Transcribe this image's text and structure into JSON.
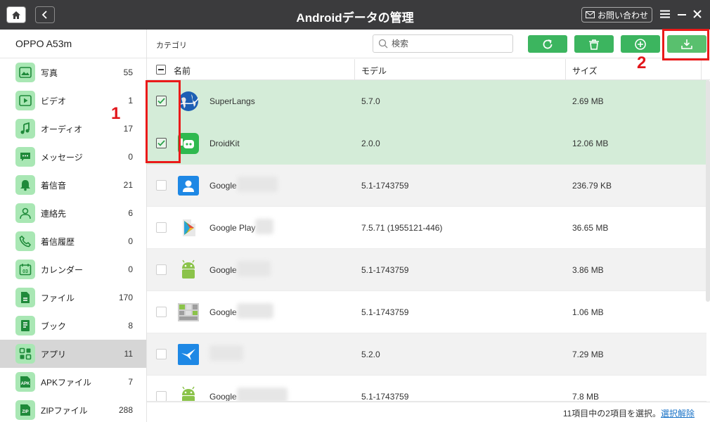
{
  "window": {
    "title": "Androidデータの管理",
    "contact_label": "お問い合わせ"
  },
  "sidebar": {
    "device": "OPPO A53m",
    "items": [
      {
        "label": "写真",
        "count": "55",
        "icon": "photo-icon"
      },
      {
        "label": "ビデオ",
        "count": "1",
        "icon": "video-icon"
      },
      {
        "label": "オーディオ",
        "count": "17",
        "icon": "music-icon"
      },
      {
        "label": "メッセージ",
        "count": "0",
        "icon": "message-icon"
      },
      {
        "label": "着信音",
        "count": "21",
        "icon": "bell-icon"
      },
      {
        "label": "連絡先",
        "count": "6",
        "icon": "contact-icon"
      },
      {
        "label": "着信履歴",
        "count": "0",
        "icon": "phone-icon"
      },
      {
        "label": "カレンダー",
        "count": "0",
        "icon": "calendar-icon"
      },
      {
        "label": "ファイル",
        "count": "170",
        "icon": "file-icon"
      },
      {
        "label": "ブック",
        "count": "8",
        "icon": "book-icon"
      },
      {
        "label": "アプリ",
        "count": "11",
        "icon": "apps-icon",
        "active": true
      },
      {
        "label": "APKファイル",
        "count": "7",
        "icon": "apk-icon"
      },
      {
        "label": "ZIPファイル",
        "count": "288",
        "icon": "zip-icon"
      }
    ]
  },
  "toolbar": {
    "category_label": "カテゴリ",
    "search_placeholder": "検索"
  },
  "table": {
    "columns": {
      "name": "名前",
      "model": "モデル",
      "size": "サイズ"
    },
    "rows": [
      {
        "name": "SuperLangs",
        "model": "5.7.0",
        "size": "2.69 MB",
        "checked": true,
        "icon": "superlangs-globe-icon"
      },
      {
        "name": "DroidKit",
        "model": "2.0.0",
        "size": "12.06 MB",
        "checked": true,
        "icon": "droidkit-icon"
      },
      {
        "name": "Google",
        "model": "5.1-1743759",
        "size": "236.79 KB",
        "checked": false,
        "icon": "google-contacts-icon",
        "obscured": true
      },
      {
        "name": "Google Play",
        "model": "7.5.71 (1955121-446)",
        "size": "36.65 MB",
        "checked": false,
        "icon": "google-play-icon",
        "obscured": true
      },
      {
        "name": "Google",
        "model": "5.1-1743759",
        "size": "3.86 MB",
        "checked": false,
        "icon": "android-robot-icon",
        "obscured": true
      },
      {
        "name": "Google",
        "model": "5.1-1743759",
        "size": "1.06 MB",
        "checked": false,
        "icon": "keyboard-app-icon",
        "obscured": true
      },
      {
        "name": "",
        "model": "5.2.0",
        "size": "7.29 MB",
        "checked": false,
        "icon": "bird-app-icon",
        "obscured": true
      },
      {
        "name": "Google",
        "model": "5.1-1743759",
        "size": "7.8 MB",
        "checked": false,
        "icon": "android-robot-icon",
        "obscured": true
      }
    ]
  },
  "status": {
    "text": "11項目中の2項目を選択。",
    "deselect": "選択解除"
  },
  "annotations": {
    "one": "1",
    "two": "2"
  },
  "colors": {
    "accent_green": "#3cb55f",
    "selected_row": "#d4ecd8",
    "annotation_red": "#ea1a1a",
    "titlebar": "#3b3b3d"
  }
}
